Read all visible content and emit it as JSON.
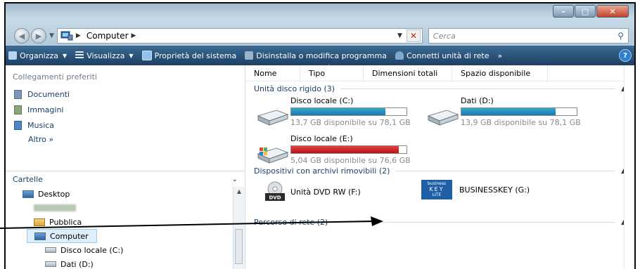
{
  "address": {
    "crumb": "Computer",
    "search_placeholder": "Cerca"
  },
  "toolbar": {
    "organizza": "Organizza",
    "visualizza": "Visualizza",
    "proprieta": "Proprietà del sistema",
    "disinstalla": "Disinstalla o modifica programma",
    "connetti": "Connetti unità di rete",
    "more": "»",
    "help": "?"
  },
  "nav": {
    "favorites_title": "Collegamenti preferiti",
    "favorites": [
      "Documenti",
      "Immagini",
      "Musica"
    ],
    "more_label": "Altro",
    "more_chev": "»",
    "folders_title": "Cartelle",
    "tree": [
      "Desktop",
      "Pubblica",
      "Computer",
      "Disco locale (C:)",
      "Dati (D:)"
    ]
  },
  "columns": [
    "Nome",
    "Tipo",
    "Dimensioni totali",
    "Spazio disponibile"
  ],
  "groups": {
    "hdd": "Unità disco rigido (3)",
    "removable": "Dispositivi con archivi rimovibili (2)",
    "network": "Percorso di rete (2)"
  },
  "drives": [
    {
      "name": "Disco locale (C:)",
      "info": "13,7 GB disponibile su 78,1 GB",
      "used_fraction": 0.82,
      "color": "#2596c0"
    },
    {
      "name": "Dati (D:)",
      "info": "13,9 GB disponibile su 78,1 GB",
      "used_fraction": 0.82,
      "color": "#2596c0"
    },
    {
      "name": "Disco locale (E:)",
      "info": "5,04 GB disponibile su 76,6 GB",
      "used_fraction": 0.93,
      "color": "#d21f1f"
    }
  ],
  "removable": [
    {
      "name": "Unità DVD RW (F:)",
      "badge": "DVD"
    },
    {
      "name": "BUSINESSKEY (G:)",
      "badge_lines": [
        "business",
        "KEY",
        "LITE"
      ]
    }
  ]
}
